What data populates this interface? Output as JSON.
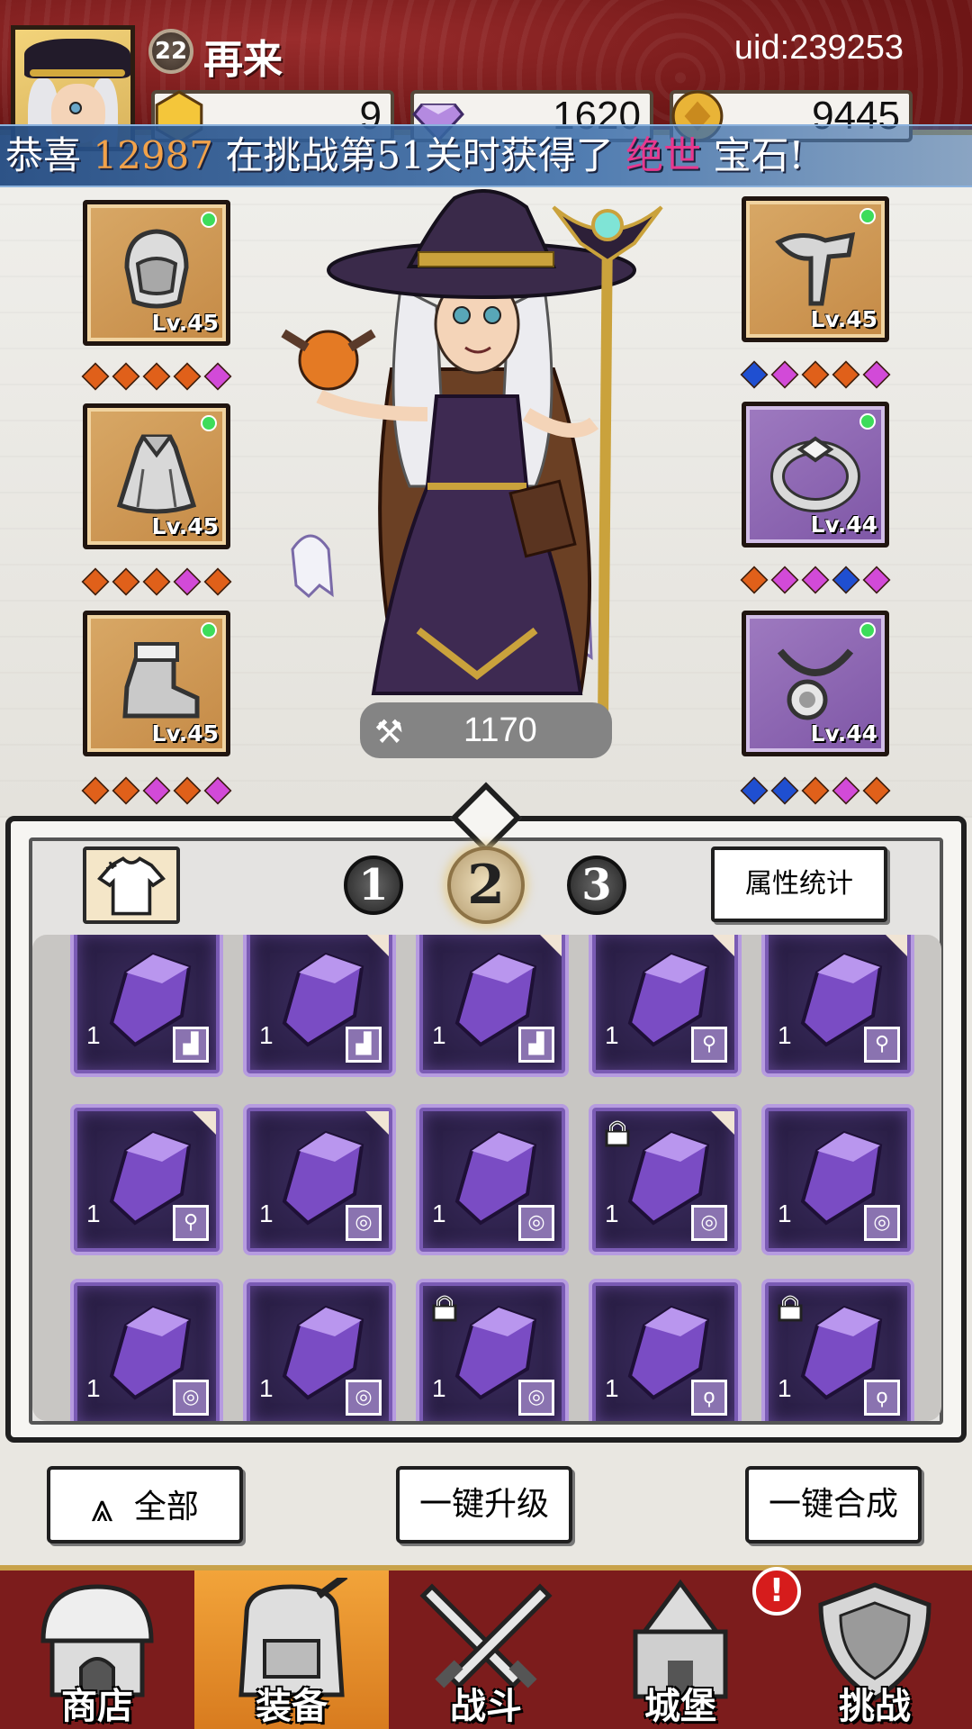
{
  "header": {
    "player_level": "22",
    "player_name": "再来",
    "uid": "uid:239253",
    "currencies": [
      {
        "icon": "gold-hexagon-icon",
        "value": "9"
      },
      {
        "icon": "purple-diamond-icon",
        "value": "1620"
      },
      {
        "icon": "gold-coin-icon",
        "value": "9445"
      }
    ]
  },
  "announcement": {
    "prefix": "恭喜 ",
    "player_id": "12987",
    "middle": " 在挑战第51关时获得了 ",
    "rarity": "绝世",
    "suffix": " 宝石!"
  },
  "equipment": {
    "left": [
      {
        "name": "helmet-slot",
        "level": "Lv.45"
      },
      {
        "name": "armor-slot",
        "level": "Lv.45"
      },
      {
        "name": "boots-slot",
        "level": "Lv.45"
      }
    ],
    "right": [
      {
        "name": "weapon-slot",
        "level": "Lv.45"
      },
      {
        "name": "ring-slot",
        "level": "Lv.44"
      },
      {
        "name": "necklace-slot",
        "level": "Lv.44"
      }
    ],
    "power": "1170"
  },
  "colors": {
    "gem_orange": "#e0601a",
    "gem_magenta": "#d24ad8",
    "gem_blue": "#1f4fd1"
  },
  "panel": {
    "tabs": [
      "1",
      "2",
      "3"
    ],
    "active_tab": "2",
    "stats_button": "属性统计",
    "items": [
      {
        "count": "1",
        "slot": "boot"
      },
      {
        "count": "1",
        "slot": "boot"
      },
      {
        "count": "1",
        "slot": "boot"
      },
      {
        "count": "1",
        "slot": "weapon"
      },
      {
        "count": "1",
        "slot": "weapon"
      },
      {
        "count": "1",
        "slot": "weapon"
      },
      {
        "count": "1",
        "slot": "ring"
      },
      {
        "count": "1",
        "slot": "ring"
      },
      {
        "count": "1",
        "slot": "ring"
      },
      {
        "count": "1",
        "slot": "ring"
      },
      {
        "count": "1",
        "slot": "ring"
      },
      {
        "count": "1",
        "slot": "ring"
      },
      {
        "count": "1",
        "slot": "ring"
      },
      {
        "count": "1",
        "slot": "necklace"
      },
      {
        "count": "1",
        "slot": "necklace"
      }
    ]
  },
  "actions": {
    "filter": "全部",
    "upgrade_all": "一键升级",
    "merge_all": "一键合成"
  },
  "nav": {
    "items": [
      "商店",
      "装备",
      "战斗",
      "城堡",
      "挑战"
    ],
    "active": "装备",
    "notification": "!"
  }
}
